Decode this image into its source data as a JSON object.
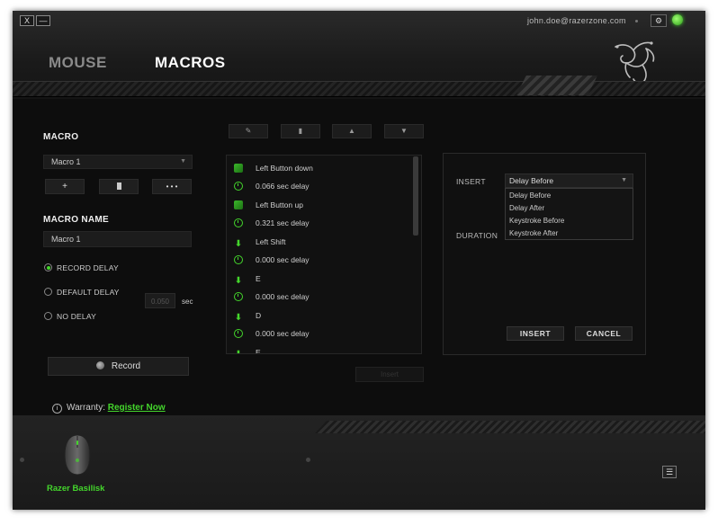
{
  "window": {
    "close_label": "X",
    "minimize_label": "—",
    "user_email": "john.doe@razerzone.com",
    "settings_icon": "gear-icon",
    "status_icon": "online-status-icon"
  },
  "nav": {
    "tabs": [
      {
        "label": "MOUSE",
        "active": false
      },
      {
        "label": "MACROS",
        "active": true
      }
    ]
  },
  "left": {
    "macro_heading": "MACRO",
    "macro_selected": "Macro 1",
    "add_label": "+",
    "delete_icon": "trash-icon",
    "more_label": "• • •",
    "macro_name_heading": "MACRO NAME",
    "macro_name_value": "Macro 1",
    "delay_options": [
      {
        "label": "RECORD DELAY",
        "selected": true
      },
      {
        "label": "DEFAULT DELAY",
        "selected": false
      },
      {
        "label": "NO DELAY",
        "selected": false
      }
    ],
    "default_delay_value": "0.050",
    "delay_unit": "sec",
    "record_label": "Record",
    "warranty_label": "Warranty:",
    "warranty_link": "Register Now"
  },
  "editor": {
    "toolbar": [
      {
        "name": "edit",
        "glyph": "✎"
      },
      {
        "name": "delete",
        "glyph": "▮"
      },
      {
        "name": "move-up",
        "glyph": "▲"
      },
      {
        "name": "move-down",
        "glyph": "▼"
      }
    ],
    "events": [
      {
        "type": "mouse",
        "text": "Left Button down"
      },
      {
        "type": "delay",
        "text": "0.066 sec delay"
      },
      {
        "type": "mouse",
        "text": "Left Button up"
      },
      {
        "type": "delay",
        "text": "0.321 sec delay"
      },
      {
        "type": "key",
        "text": "Left Shift"
      },
      {
        "type": "delay",
        "text": "0.000 sec delay"
      },
      {
        "type": "key",
        "text": "E"
      },
      {
        "type": "delay",
        "text": "0.000 sec delay"
      },
      {
        "type": "key",
        "text": "D"
      },
      {
        "type": "delay",
        "text": "0.000 sec delay"
      },
      {
        "type": "key",
        "text": "E"
      }
    ],
    "insert_label": "Insert"
  },
  "insert_panel": {
    "insert_label": "INSERT",
    "duration_label": "DURATION",
    "selected": "Delay Before",
    "options": [
      "Delay Before",
      "Delay After",
      "Keystroke Before",
      "Keystroke After"
    ],
    "insert_button": "INSERT",
    "cancel_button": "CANCEL"
  },
  "footer": {
    "device_name": "Razer Basilisk",
    "menu_icon": "menu-icon"
  },
  "colors": {
    "accent": "#44d62c",
    "background": "#0d0d0d"
  }
}
